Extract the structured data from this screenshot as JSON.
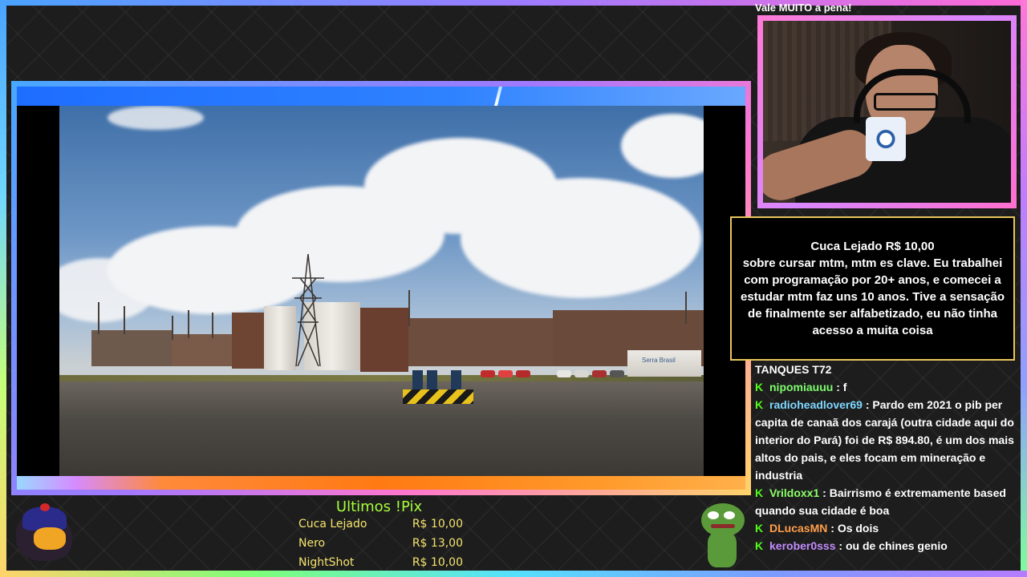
{
  "chat_top_text": "Vale MUITO a pena!",
  "highlight": {
    "title": "Cuca Lejado R$ 10,00",
    "message": "sobre cursar mtm, mtm es clave. Eu trabalhei com programação por 20+ anos, e comecei a estudar mtm faz uns 10 anos. Tive a sensação de finalmente ser alfabetizado, eu não tinha acesso a muita coisa"
  },
  "chat": {
    "preface": "TANQUES T72",
    "messages": [
      {
        "badge": "K",
        "user": "nipomiauuu",
        "user_color": "#7dfc6c",
        "text": "f"
      },
      {
        "badge": "K",
        "user": "radioheadlover69",
        "user_color": "#7ed8ff",
        "text": "Pardo em 2021 o pib per capita de canaã dos carajá (outra cidade aqui do interior do Pará) foi de R$ 894.80, é um dos mais altos do pais, e eles focam em mineração e industria"
      },
      {
        "badge": "K",
        "user": "Vrildoxx1",
        "user_color": "#8cff6a",
        "text": "Bairrismo é extremamente based quando sua cidade é boa"
      },
      {
        "badge": "K",
        "user": "DLucasMN",
        "user_color": "#ff9e4a",
        "text": "Os dois"
      },
      {
        "badge": "K",
        "user": "kerober0sss",
        "user_color": "#c38cff",
        "text": "ou de chines genio"
      }
    ]
  },
  "pix": {
    "title": "Ultimos !Pix",
    "rows": [
      {
        "name": "Cuca Lejado",
        "amount": "R$ 10,00"
      },
      {
        "name": "Nero",
        "amount": "R$ 13,00"
      },
      {
        "name": "NightShot",
        "amount": "R$ 10,00"
      }
    ]
  },
  "photo": {
    "truck_text": "Serra Brasil"
  },
  "colors": {
    "kick_green": "#53fc18",
    "pix_title": "#a6ff3a",
    "pix_rows": "#f5e36e",
    "highlight_border": "#e8c65a"
  }
}
